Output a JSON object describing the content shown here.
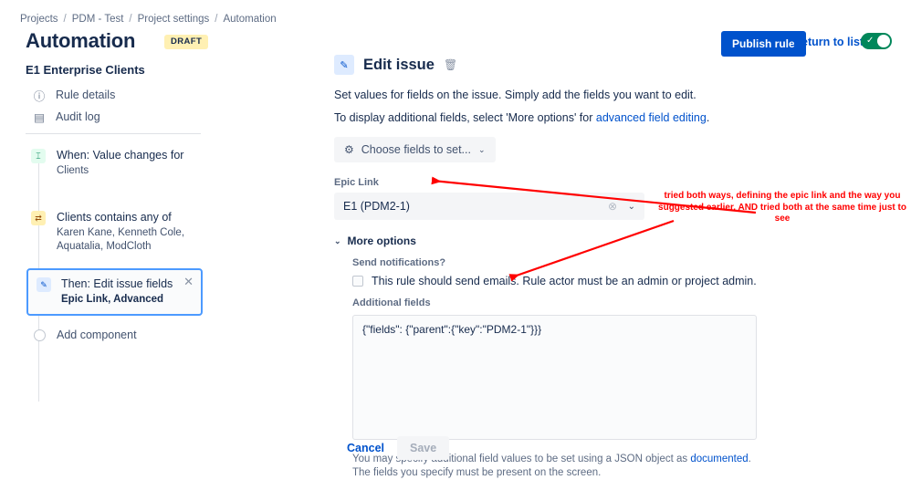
{
  "breadcrumb": {
    "items": [
      "Projects",
      "PDM - Test",
      "Project settings",
      "Automation"
    ],
    "separator": "/"
  },
  "header": {
    "title": "Automation",
    "badge": "DRAFT",
    "publish_label": "Publish rule",
    "return_label": "Return to list",
    "toggle_state": "on",
    "toggle_check": "✓"
  },
  "sidebar": {
    "rule_name": "E1 Enterprise Clients",
    "nav": [
      {
        "label": "Rule details",
        "icon": "info-icon",
        "glyph": "ⓘ"
      },
      {
        "label": "Audit log",
        "icon": "audit-log-icon",
        "glyph": "▤"
      }
    ],
    "chain": [
      {
        "title": "When: Value changes for",
        "sub": "Clients",
        "icon": "trigger-icon",
        "glyph": "⌶"
      },
      {
        "title": "Clients contains any of",
        "sub": "Karen Kane, Kenneth Cole, Aquatalia, ModCloth",
        "icon": "condition-icon",
        "glyph": "⇄"
      },
      {
        "title": "Then: Edit issue fields",
        "sub": "Epic Link, Advanced",
        "icon": "edit-pencil-icon",
        "glyph": "✎",
        "close_glyph": "✕"
      }
    ],
    "add_component": "Add component"
  },
  "main": {
    "title": "Edit issue",
    "icon": "edit-pencil-icon",
    "icon_glyph": "✎",
    "trash_glyph": "🗑",
    "description": "Set values for fields on the issue. Simply add the fields you want to edit.",
    "description2_prefix": "To display additional fields, select 'More options' for ",
    "description2_link": "advanced field editing",
    "description2_suffix": ".",
    "choose_fields_label": "Choose fields to set...",
    "choose_fields_gear": "⚙",
    "choose_fields_caret": "⌄",
    "epic_link": {
      "label": "Epic Link",
      "value": "E1 (PDM2-1)",
      "clear_glyph": "⊗",
      "caret_glyph": "⌄"
    },
    "more_options": {
      "label": "More options",
      "caret": "⌄",
      "send_notifications_label": "Send notifications?",
      "checkbox_label": "This rule should send emails. Rule actor must be an admin or project admin.",
      "checkbox_checked": false,
      "additional_fields_label": "Additional fields",
      "additional_fields_value": "{\"fields\": {\"parent\":{\"key\":\"PDM2-1\"}}}",
      "helper_prefix": "You may specify additional field values to be set using a JSON object as ",
      "helper_link": "documented",
      "helper_suffix": ". The fields you specify must be present on the screen."
    },
    "cancel_label": "Cancel",
    "save_label": "Save"
  },
  "annotations": {
    "note": "tried both ways, defining the epic link and the way you suggested earlier, AND tried both at the same time just to see",
    "color": "#FF0000"
  }
}
